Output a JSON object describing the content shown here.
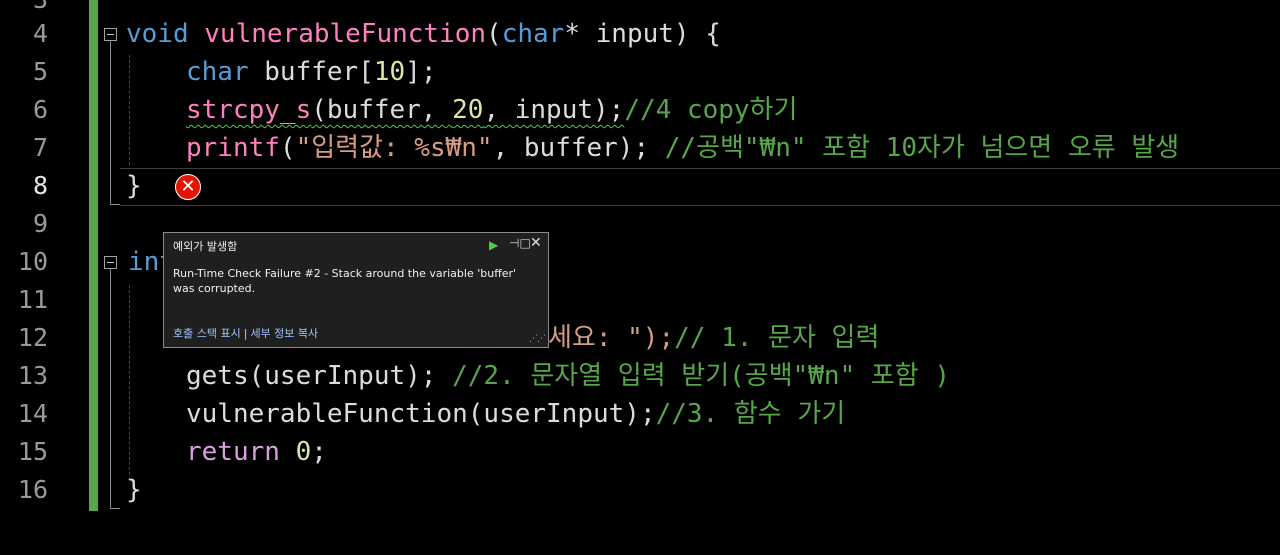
{
  "editor": {
    "line_numbers": [
      "4",
      "5",
      "6",
      "7",
      "8",
      "9",
      "10",
      "11",
      "12",
      "13",
      "14",
      "15",
      "16"
    ],
    "current_line": "8",
    "partial_top_line": "3",
    "lines": {
      "l4": {
        "kw": "void",
        "fn": "vulnerableFunction",
        "open": "(",
        "type": "char",
        "star": "*",
        "param": " input",
        "close": ") {"
      },
      "l5": {
        "type": "char",
        "rest": " buffer[",
        "num": "10",
        "end": "];"
      },
      "l6": {
        "fn": "strcpy_s",
        "rest1": "(buffer, ",
        "num": "20",
        "rest2": ", input);",
        "comment": "//4 copy하기"
      },
      "l7": {
        "fn": "printf",
        "open": "(",
        "str": "\"입력값: %s₩n\"",
        "rest": ", buffer); ",
        "comment": "//공백\"₩n\" 포함 10자가 넘으면 오류 발생"
      },
      "l8": {
        "brace": "}"
      },
      "l10": {
        "kw": "int"
      },
      "l12": {
        "visible_tail": "세요: \");",
        "comment": "// 1. 문자 입력"
      },
      "l13": {
        "text": "gets(userInput); ",
        "comment": "//2. 문자열 입력 받기(공백\"₩n\" 포함 )"
      },
      "l14": {
        "text": "vulnerableFunction(userInput);",
        "comment": "//3. 함수 가기"
      },
      "l15": {
        "kw": "return",
        "num": "0",
        "end": ";"
      },
      "l16": {
        "brace": "}"
      }
    }
  },
  "exception_popup": {
    "title": "예외가 발생함",
    "message": "Run-Time Check Failure #2 - Stack around the variable 'buffer' was corrupted.",
    "link_call_stack": "호출 스택 표시",
    "link_separator": "|",
    "link_details": "세부 정보 복사",
    "continue_icon": "play-icon",
    "pin_icon": "pin-icon",
    "close_icon": "close-icon"
  },
  "error_icon": "error-icon",
  "colors": {
    "background": "#000000",
    "keyword": "#569cd6",
    "function": "#ff80c0",
    "comment": "#57a64a",
    "number": "#d9e6a8",
    "string": "#d69d85",
    "error": "#e51400",
    "change_bar": "#57a64a"
  }
}
